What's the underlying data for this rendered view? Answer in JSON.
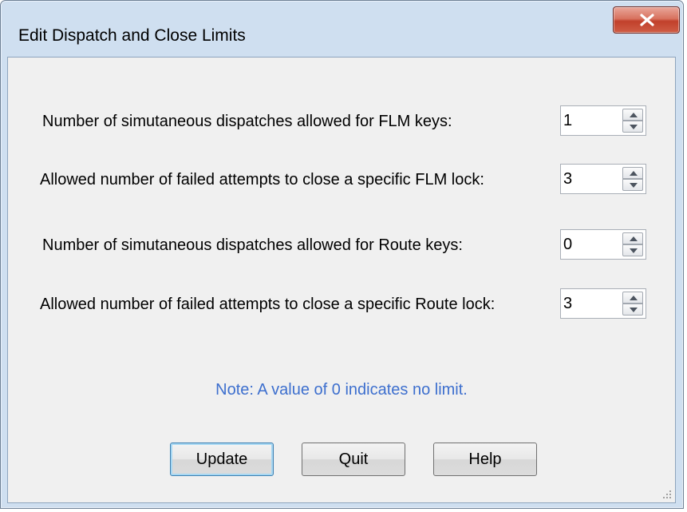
{
  "window": {
    "title": "Edit Dispatch and Close Limits",
    "close_icon": "close-icon"
  },
  "fields": [
    {
      "label": "Number of simutaneous dispatches allowed for FLM keys:",
      "value": "1"
    },
    {
      "label": "Allowed number of failed attempts to close a specific FLM lock:",
      "value": "3"
    },
    {
      "label": "Number of simutaneous dispatches allowed for Route keys:",
      "value": "0"
    },
    {
      "label": "Allowed number of failed attempts to close a specific Route lock:",
      "value": "3"
    }
  ],
  "note": "Note: A value of 0 indicates no limit.",
  "buttons": {
    "update": "Update",
    "quit": "Quit",
    "help": "Help"
  },
  "colors": {
    "note": "#3d6fce",
    "close_button": "#c1402b",
    "frame": "#cfdff0"
  }
}
